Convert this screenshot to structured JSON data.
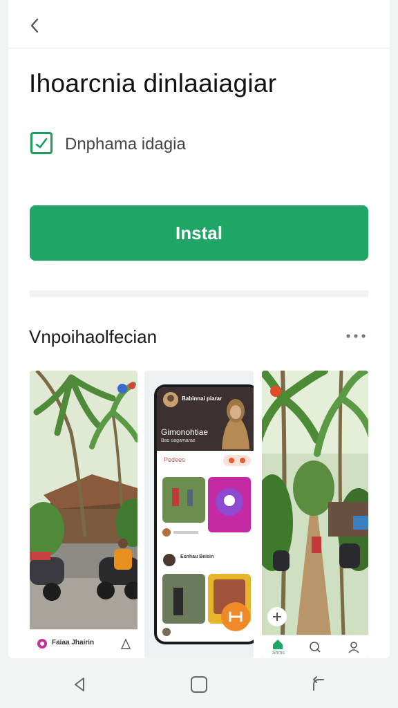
{
  "header": {
    "title": "Ihoarcnia dinlaaiagiar"
  },
  "option": {
    "label": "Dnphama idagia",
    "checked": true
  },
  "install_button": {
    "label": "Instal"
  },
  "screenshots": {
    "section_title": "Vnpoihaolfecian",
    "shot1": {
      "label": "Faiaa Jhairin"
    },
    "shot2": {
      "card_title": "Gimonohtiae",
      "card_sub": "Bao oagamarae",
      "header_name": "Babinnai piarar",
      "section_label": "Pedees",
      "post_name": "Esnhau Beisin"
    },
    "shot3": {
      "nav_label": "Shms"
    }
  },
  "colors": {
    "accent": "#1fa566",
    "check": "#1a9c5c"
  }
}
